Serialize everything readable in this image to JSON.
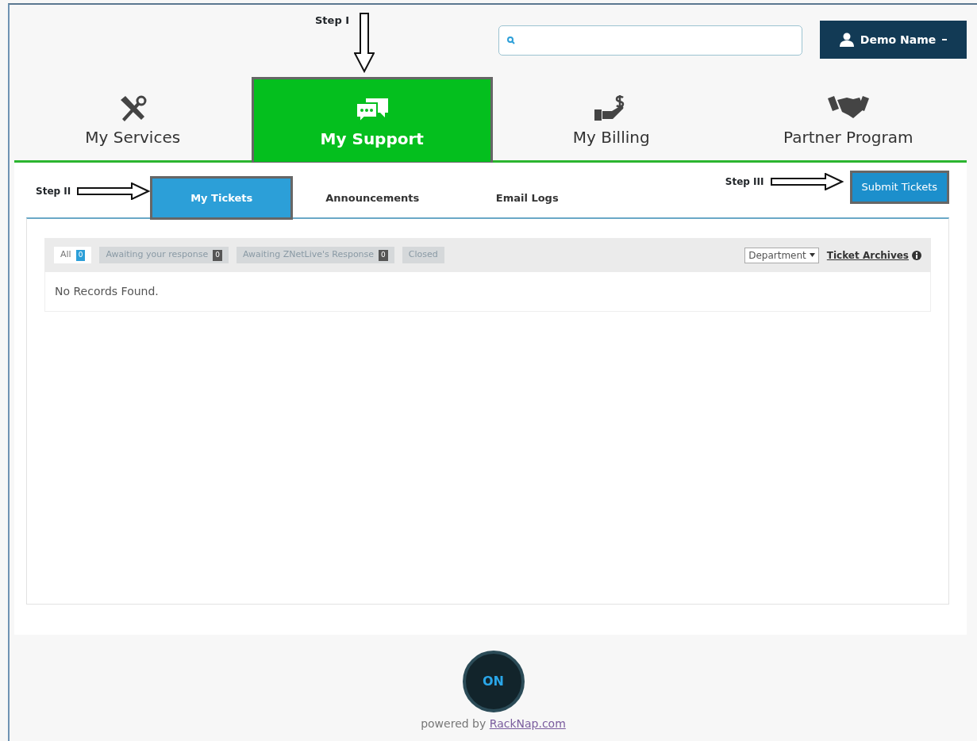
{
  "header": {
    "annotation": {
      "label": "Step I"
    },
    "user_menu": {
      "label": "Demo Name"
    }
  },
  "main_tabs": [
    {
      "label": "My Services",
      "selected": false
    },
    {
      "label": "My Support",
      "selected": true
    },
    {
      "label": "My Billing",
      "selected": false
    },
    {
      "label": "Partner Program",
      "selected": false
    }
  ],
  "sub_nav": {
    "annotations": [
      {
        "label": "Step II"
      },
      {
        "label": "Step III"
      }
    ],
    "tabs": [
      {
        "label": "My Tickets",
        "selected": true
      },
      {
        "label": "Announcements",
        "selected": false
      },
      {
        "label": "Email Logs",
        "selected": false
      }
    ],
    "submit_button": "Submit Tickets"
  },
  "tickets": {
    "filters": [
      {
        "label": "All",
        "count": "0",
        "selected": true
      },
      {
        "label": "Awaiting your response",
        "count": "0",
        "selected": false
      },
      {
        "label": "Awaiting ZNetLive's Response",
        "count": "0",
        "selected": false
      },
      {
        "label": "Closed",
        "selected": false
      }
    ],
    "department_select": "Department",
    "archives_link": "Ticket Archives",
    "empty_message": "No Records Found."
  },
  "footer": {
    "logo_text": "ON",
    "powered_by": "powered by",
    "link": "RackNap.com"
  }
}
